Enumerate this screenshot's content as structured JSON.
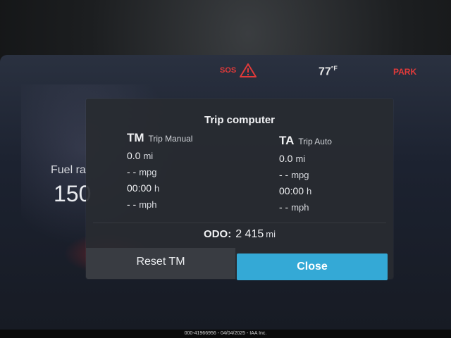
{
  "status_bar": {
    "sos": "SOS",
    "warning_icon": "warning-triangle-icon",
    "temperature": "77",
    "temperature_unit": "°F",
    "park": "PARK"
  },
  "background_widget": {
    "label": "Fuel ra",
    "value": "150"
  },
  "trip_computer": {
    "title": "Trip computer",
    "tm": {
      "abbr": "TM",
      "name": "Trip Manual",
      "distance": "0.0",
      "distance_unit": "mi",
      "consumption": "- -",
      "consumption_unit": "mpg",
      "time": "00:00",
      "time_unit": "h",
      "speed": "- -",
      "speed_unit": "mph"
    },
    "ta": {
      "abbr": "TA",
      "name": "Trip Auto",
      "distance": "0.0",
      "distance_unit": "mi",
      "consumption": "- -",
      "consumption_unit": "mpg",
      "time": "00:00",
      "time_unit": "h",
      "speed": "- -",
      "speed_unit": "mph"
    },
    "odo_label": "ODO:",
    "odo_value": "2 415",
    "odo_unit": "mi",
    "reset_button": "Reset TM",
    "close_button": "Close"
  },
  "caption": "000-41966956 - 04/04/2025 - IAA Inc.",
  "colors": {
    "alert_red": "#e23a3a",
    "close_button_blue": "#34a9d6"
  }
}
